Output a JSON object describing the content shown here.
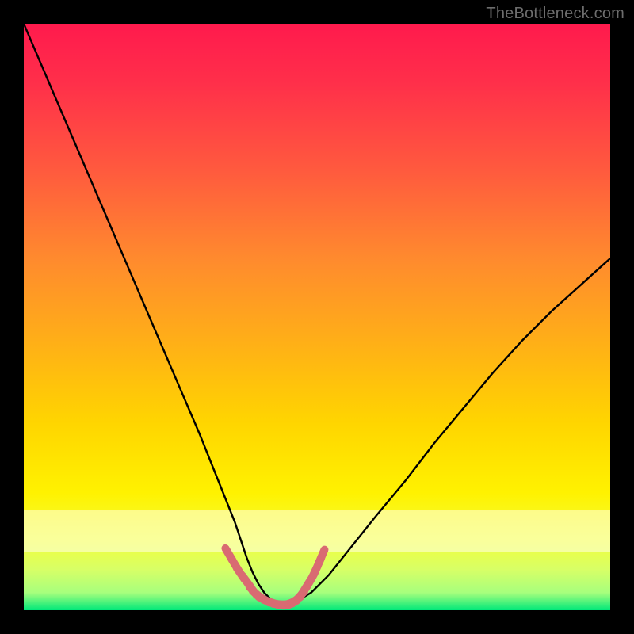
{
  "watermark": "TheBottleneck.com",
  "colors": {
    "frame": "#000000",
    "curve_stroke": "#000000",
    "marker_stroke": "#d96a72",
    "pale_band": "rgba(255,255,235,0.55)"
  },
  "chart_data": {
    "type": "line",
    "title": "",
    "xlabel": "",
    "ylabel": "",
    "xlim": [
      0,
      100
    ],
    "ylim": [
      0,
      100
    ],
    "grid": false,
    "legend": false,
    "series": [
      {
        "name": "bottleneck-curve",
        "x": [
          0,
          3,
          6,
          9,
          12,
          15,
          18,
          21,
          24,
          27,
          30,
          32,
          34,
          36,
          37,
          38,
          39,
          40,
          41,
          42,
          43,
          44,
          45,
          46,
          47,
          49,
          52,
          56,
          60,
          65,
          70,
          75,
          80,
          85,
          90,
          95,
          100
        ],
        "y": [
          100,
          93,
          86,
          79,
          72,
          65,
          58,
          51,
          44,
          37,
          30,
          25,
          20,
          15,
          12,
          9,
          6.5,
          4.5,
          3,
          2,
          1.3,
          1,
          1,
          1.2,
          1.8,
          3,
          6,
          11,
          16,
          22,
          28.5,
          34.5,
          40.5,
          46,
          51,
          55.5,
          60
        ]
      }
    ],
    "markers": {
      "name": "bottom-markers",
      "x": [
        35,
        36,
        37,
        38,
        38.7,
        39.3,
        40,
        40.7,
        41.5,
        42.3,
        43,
        43.8,
        44.6,
        45.4,
        46.2,
        47,
        47.7,
        48.3,
        49,
        49.6,
        50.2,
        50.8
      ],
      "y": [
        9.5,
        7.8,
        6.2,
        4.9,
        3.9,
        3.1,
        2.5,
        2.0,
        1.6,
        1.3,
        1.1,
        1.0,
        1.0,
        1.2,
        1.6,
        2.3,
        3.2,
        4.2,
        5.3,
        6.5,
        7.8,
        9.2
      ]
    },
    "pale_band_y": [
      10,
      17
    ]
  }
}
